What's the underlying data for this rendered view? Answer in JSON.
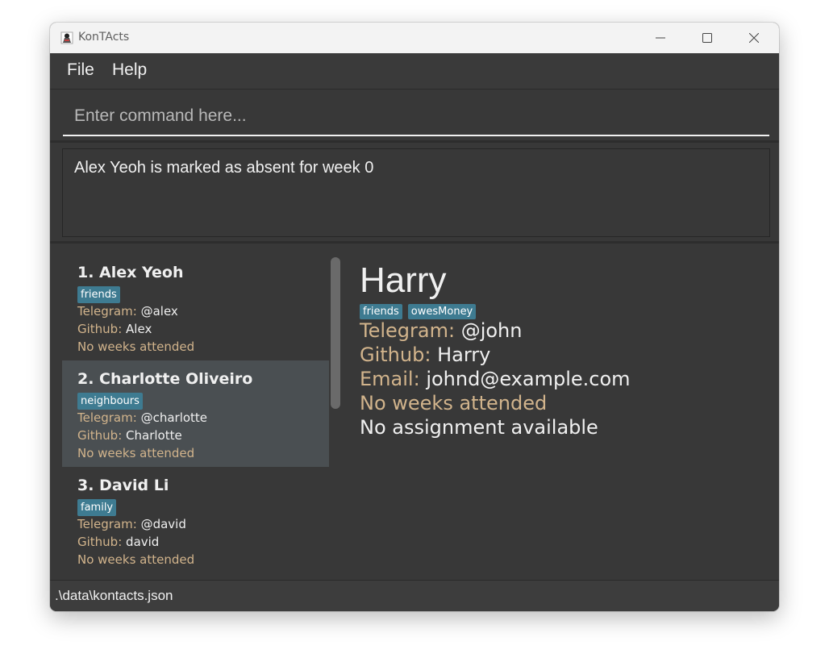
{
  "window": {
    "title": "KonTActs"
  },
  "menu": {
    "file": "File",
    "help": "Help"
  },
  "command": {
    "placeholder": "Enter command here...",
    "value": ""
  },
  "result": {
    "message": "Alex Yeoh is marked as absent for week 0"
  },
  "contacts": [
    {
      "index_name": "1. Alex Yeoh",
      "tag": "friends",
      "telegram_label": "Telegram:",
      "telegram": "@alex",
      "github_label": "Github:",
      "github": "Alex",
      "weeks": "No weeks attended",
      "selected": false
    },
    {
      "index_name": "2. Charlotte Oliveiro",
      "tag": "neighbours",
      "telegram_label": "Telegram:",
      "telegram": "@charlotte",
      "github_label": "Github:",
      "github": "Charlotte",
      "weeks": "No weeks attended",
      "selected": true
    },
    {
      "index_name": "3. David Li",
      "tag": "family",
      "telegram_label": "Telegram:",
      "telegram": "@david",
      "github_label": "Github:",
      "github": "david",
      "weeks": "No weeks attended",
      "selected": false
    }
  ],
  "detail": {
    "name": "Harry",
    "tags": [
      "friends",
      "owesMoney"
    ],
    "telegram_label": "Telegram:",
    "telegram": "@john",
    "github_label": "Github:",
    "github": "Harry",
    "email_label": "Email:",
    "email": "johnd@example.com",
    "weeks": "No weeks attended",
    "assignment": "No assignment available"
  },
  "status": {
    "path": ".\\data\\kontacts.json"
  },
  "colors": {
    "background": "#383838",
    "label": "#d2b48c",
    "tag": "#3e7b91",
    "selected_card": "#4a4f52"
  },
  "icons": {
    "app": "app-icon",
    "minimize": "minimize-icon",
    "maximize": "maximize-icon",
    "close": "close-icon"
  }
}
